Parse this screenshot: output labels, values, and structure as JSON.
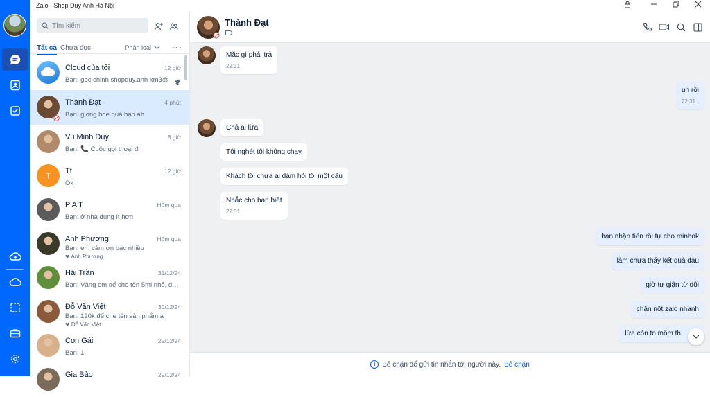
{
  "window": {
    "title": "Zalo - Shop Duy Anh Hà Nội"
  },
  "sidebar": {
    "nav_icons": [
      "chat-icon",
      "contacts-icon",
      "todo-icon",
      "cloud-sync-icon",
      "cloud-icon",
      "screenshot-icon",
      "toolbox-icon",
      "settings-icon"
    ]
  },
  "conv_list": {
    "search_placeholder": "Tìm kiếm",
    "tab_all": "Tất cả",
    "tab_unread": "Chưa đọc",
    "sort_label": "Phân loại",
    "more_label": "···",
    "items": [
      {
        "name": "Cloud của tôi",
        "preview": "Bạn: goc chinh shopduy.anh km3@",
        "time": "12 giờ",
        "color": "#2f8de4",
        "pinned": true
      },
      {
        "name": "Thành Đạt",
        "preview": "Bạn: giong bde quá bạn ah",
        "time": "4 phút",
        "color": "#6a4a33"
      },
      {
        "name": "Vũ Minh Duy",
        "preview": "Bạn: 📞 Cuộc gọi thoại đi",
        "time": "8 giờ",
        "color": "#b08a6a"
      },
      {
        "name": "Tt",
        "preview": "Ok",
        "time": "12 giờ",
        "color": "#f7931e",
        "initial": "T"
      },
      {
        "name": "P A T",
        "preview": "Bạn: ở nhà dùng ít hơn",
        "time": "Hôm qua",
        "color": "#5b5b5b"
      },
      {
        "name": "Anh Phương",
        "preview": "Bạn: em cảm ơn bác nhiều",
        "time": "Hôm qua",
        "color": "#3a3a2a",
        "reaction": "❤ Anh Phương"
      },
      {
        "name": "Hải Trần",
        "preview": "Bạn: Vâng em để che tên 5ml nhỏ, đơ...",
        "time": "31/12/24",
        "color": "#5f8f3a"
      },
      {
        "name": "Đỗ Văn Việt",
        "preview": "Bạn: 120k để che tên sản phẩm ạ",
        "time": "30/12/24",
        "color": "#8a5a3a",
        "reaction": "❤ Đỗ Văn Việt"
      },
      {
        "name": "Con Gái",
        "preview": "Bạn: 1",
        "time": "29/12/24",
        "color": "#d8b08a"
      },
      {
        "name": "Gia Bảo",
        "preview": "",
        "time": "29/12/24",
        "color": "#7a6a5a"
      }
    ]
  },
  "chat": {
    "contact_name": "Thành Đạt",
    "messages": [
      {
        "text": "Mắc gì phải trả",
        "time": "22:31",
        "dir": "in"
      },
      {
        "text": "uh rồi",
        "time": "22:31",
        "dir": "out"
      },
      {
        "text": "Chả ai lừa",
        "time": "",
        "dir": "in"
      },
      {
        "text": "Tôi nghét tôi không chạy",
        "time": "",
        "dir": "in"
      },
      {
        "text": "Khách tôi chưa ai dám hỏi tôi một câu",
        "time": "",
        "dir": "in"
      },
      {
        "text": "Nhắc cho bạn biết",
        "time": "22:31",
        "dir": "in"
      },
      {
        "text": "bạn nhận tiền rồi tự cho minhok",
        "time": "",
        "dir": "out"
      },
      {
        "text": "làm chưa thấy kết quả đâu",
        "time": "",
        "dir": "out"
      },
      {
        "text": "giờ tự giận từ dỗi",
        "time": "",
        "dir": "out"
      },
      {
        "text": "chặn nốt zalo nhanh",
        "time": "",
        "dir": "out"
      },
      {
        "text": "lừa còn to mồm th",
        "time": "",
        "dir": "out"
      }
    ],
    "footer_text": "Bỏ chặn để gửi tin nhắn tới người này.",
    "footer_link": "Bỏ chặn"
  }
}
